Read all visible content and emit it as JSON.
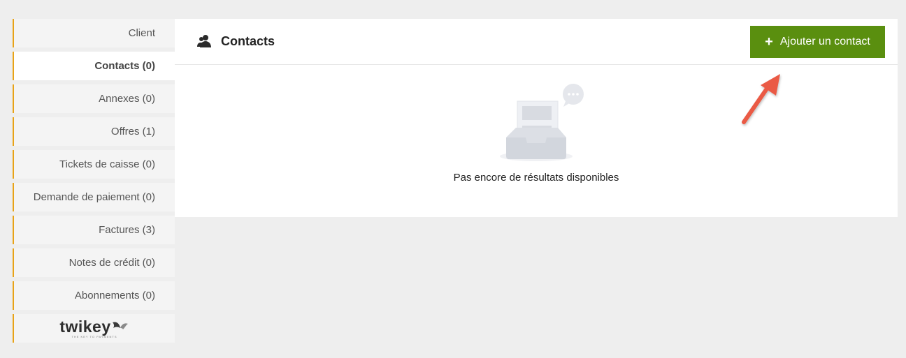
{
  "sidebar": {
    "items": [
      {
        "label": "Client"
      },
      {
        "label": "Contacts (0)"
      },
      {
        "label": "Annexes (0)"
      },
      {
        "label": "Offres (1)"
      },
      {
        "label": "Tickets de caisse (0)"
      },
      {
        "label": "Demande de paiement (0)"
      },
      {
        "label": "Factures (3)"
      },
      {
        "label": "Notes de crédit (0)"
      },
      {
        "label": "Abonnements (0)"
      }
    ],
    "logo": {
      "wordmark": "twikey",
      "tagline": "THE KEY TO PAYMENTS"
    }
  },
  "main": {
    "title": "Contacts",
    "add_button_label": "Ajouter un contact",
    "empty_message": "Pas encore de résultats disponibles"
  },
  "colors": {
    "accent": "#e8a317",
    "button": "#5a8f0f",
    "arrow": "#ea5a45"
  }
}
